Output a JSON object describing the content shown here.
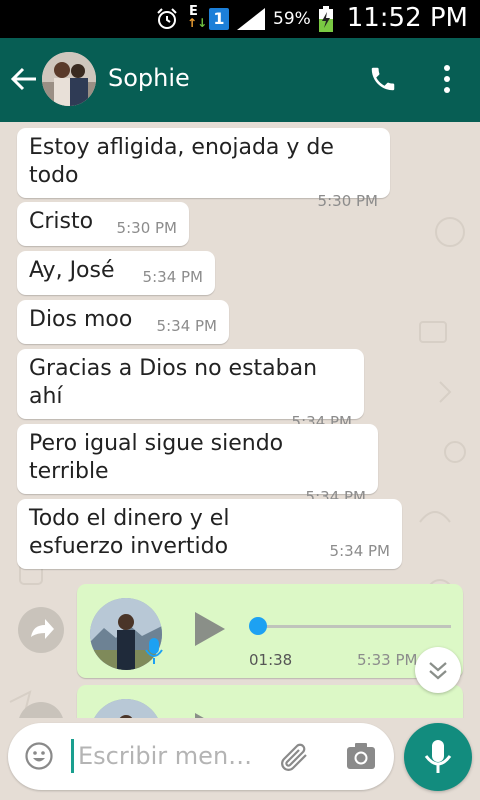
{
  "status_bar": {
    "battery_percent": "59%",
    "time": "11:52 PM",
    "network_label": "E",
    "sim_label": "1",
    "icons": [
      "alarm-icon",
      "data-arrows-icon",
      "sim-icon",
      "signal-icon",
      "battery-charging-icon"
    ]
  },
  "header": {
    "contact_name": "Sophie",
    "icons": [
      "back-arrow-icon",
      "contact-avatar",
      "phone-icon",
      "more-vert-icon"
    ],
    "color": "#075e54"
  },
  "messages": [
    {
      "text": "Estoy afligida, enojada y de todo",
      "time": "5:30 PM"
    },
    {
      "text": "Cristo",
      "time": "5:30 PM"
    },
    {
      "text": "Ay, José",
      "time": "5:34 PM"
    },
    {
      "text": "Dios moo",
      "time": "5:34 PM"
    },
    {
      "text": "Gracias a Dios no estaban ahí",
      "time": "5:34 PM"
    },
    {
      "text": "Pero igual sigue siendo terrible",
      "time": "5:34 PM"
    },
    {
      "text": "Todo el dinero y el esfuerzo invertido",
      "time": "5:34 PM"
    }
  ],
  "voice_messages": [
    {
      "duration": "01:38",
      "time": "5:33 PM",
      "progress": 0
    }
  ],
  "composer": {
    "placeholder": "Escribir men…",
    "icons": [
      "emoji-icon",
      "attach-icon",
      "camera-icon",
      "mic-icon"
    ]
  },
  "colors": {
    "incoming_bubble": "#ffffff",
    "outgoing_bubble": "#dcf8c6",
    "chat_background": "#e5ddd5",
    "accent": "#128c7e"
  }
}
